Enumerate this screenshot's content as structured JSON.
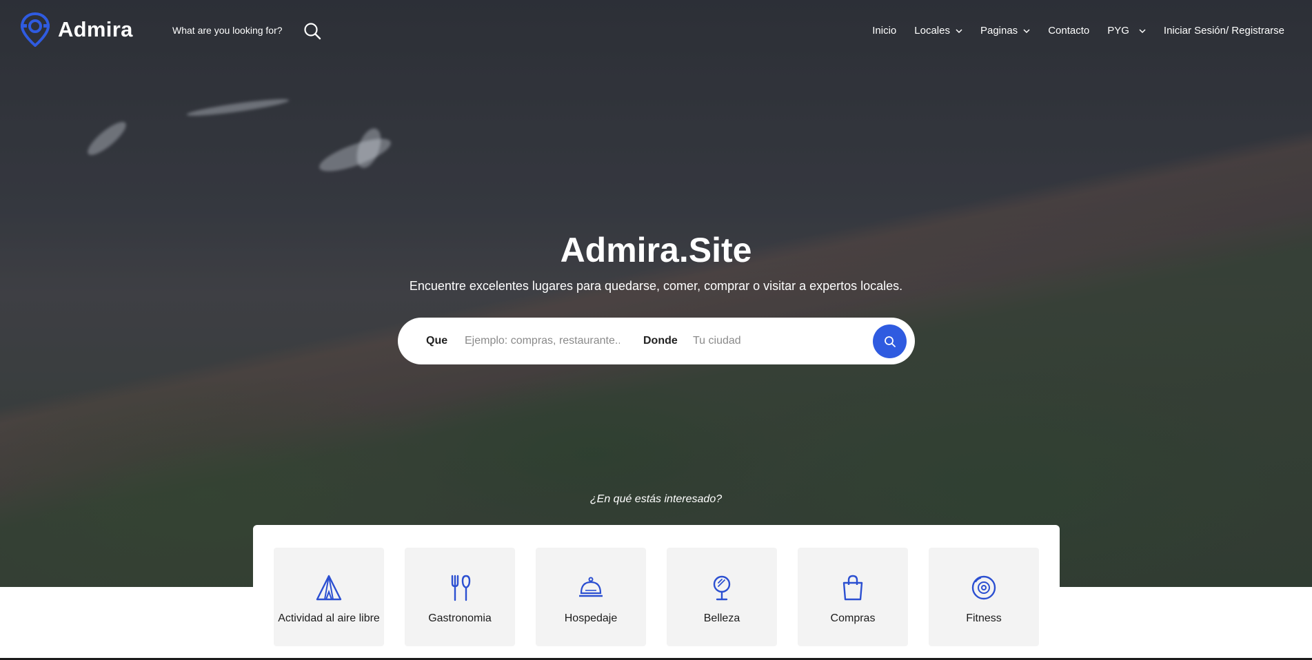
{
  "header": {
    "logo_text": "Admira",
    "search_prompt": "What are you looking for?",
    "nav": [
      {
        "label": "Inicio",
        "dropdown": false
      },
      {
        "label": "Locales",
        "dropdown": true
      },
      {
        "label": "Paginas",
        "dropdown": true
      },
      {
        "label": "Contacto",
        "dropdown": false
      },
      {
        "label": "PYG",
        "dropdown": true
      },
      {
        "label": "Iniciar Sesión/ Registrarse",
        "dropdown": false
      }
    ]
  },
  "hero": {
    "title": "Admira.Site",
    "subtitle": "Encuentre excelentes lugares para quedarse, comer, comprar o visitar a expertos locales."
  },
  "search": {
    "what_label": "Que",
    "what_placeholder": "Ejemplo: compras, restaurante...",
    "where_label": "Donde",
    "where_placeholder": "Tu ciudad",
    "button_icon": "search-icon"
  },
  "interest_prompt": "¿En qué estás interesado?",
  "categories": [
    {
      "label": "Actividad al aire libre",
      "icon": "tent-icon"
    },
    {
      "label": "Gastronomia",
      "icon": "fork-knife-icon"
    },
    {
      "label": "Hospedaje",
      "icon": "service-bell-icon"
    },
    {
      "label": "Belleza",
      "icon": "mirror-icon"
    },
    {
      "label": "Compras",
      "icon": "shopping-bag-icon"
    },
    {
      "label": "Fitness",
      "icon": "weight-plate-icon"
    }
  ],
  "colors": {
    "accent": "#2f5be0",
    "icon_blue": "#2b4fd1",
    "card_bg": "#f3f3f3"
  }
}
